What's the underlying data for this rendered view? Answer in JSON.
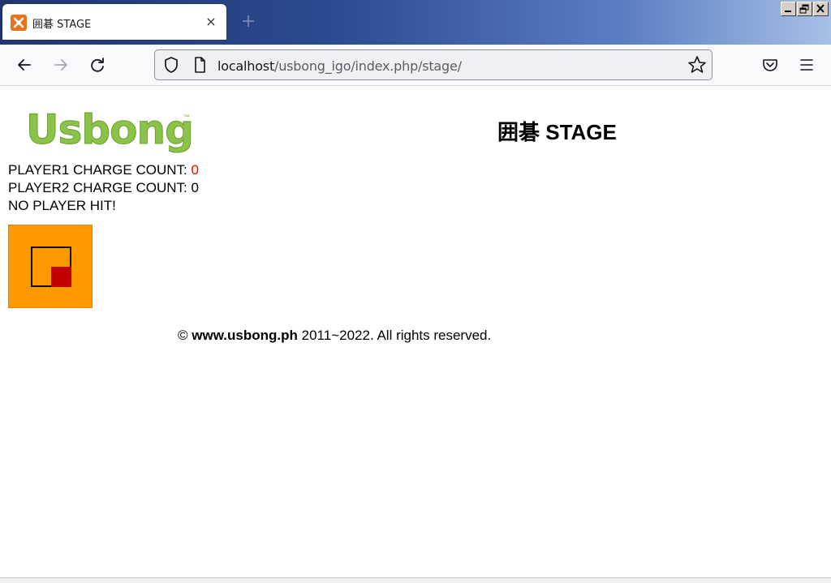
{
  "tab": {
    "title": "囲碁 STAGE",
    "close_glyph": "×",
    "new_tab_glyph": "+"
  },
  "window": {
    "minimize": "minimize",
    "restore": "restore",
    "close": "close"
  },
  "nav": {
    "url_host": "localhost",
    "url_path": "/usbong_igo/index.php/stage/"
  },
  "page": {
    "logo_text": "Usbong",
    "logo_tm": "™",
    "heading": "囲碁 STAGE",
    "player1_label": "PLAYER1 CHARGE COUNT: ",
    "player1_count": "0",
    "player2_label": "PLAYER2 CHARGE COUNT: ",
    "player2_count": "0",
    "hit_status": "NO PLAYER HIT!",
    "footer_copy": "©",
    "footer_site": "www.usbong.ph",
    "footer_rest": "2011~2022. All rights reserved."
  },
  "colors": {
    "stage_bg": "#ff9900",
    "player2": "#c40000",
    "logo": "#8bc34a",
    "charge_highlight": "#ff0000"
  }
}
